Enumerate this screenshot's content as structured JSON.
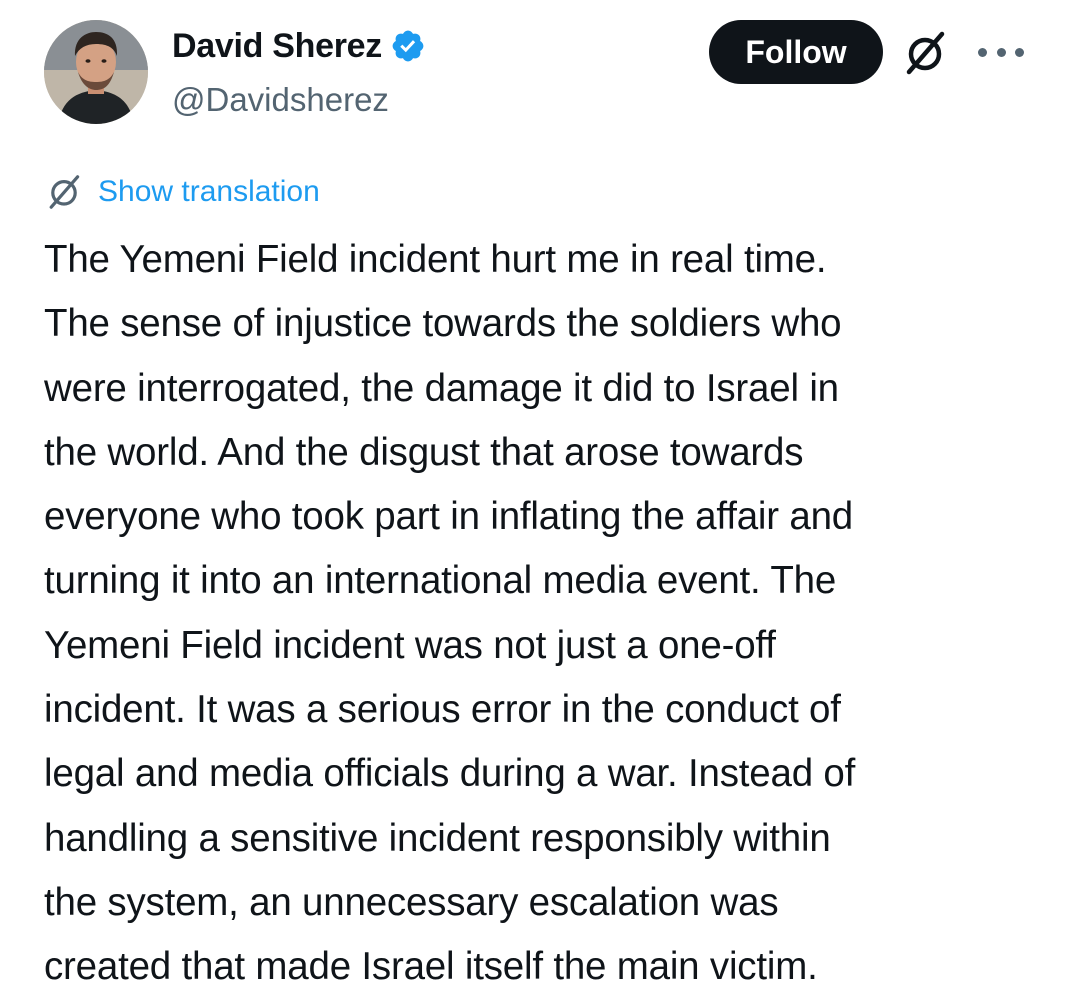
{
  "author": {
    "display_name": "David Sherez",
    "handle": "@Davidsherez",
    "verified": true
  },
  "actions": {
    "follow_label": "Follow",
    "grok_icon": "grok-icon",
    "more_icon": "more-icon"
  },
  "translation": {
    "label": "Show translation"
  },
  "tweet": {
    "lines": [
      "The Yemeni Field incident hurt me in real time.",
      "The sense of injustice towards the soldiers who",
      "were interrogated, the damage it did to Israel in",
      "the world. And the disgust that arose towards",
      "everyone who took part in inflating the affair and",
      "turning it into an international media event. The",
      "Yemeni Field incident was not just a one-off",
      "incident. It was a serious error in the conduct of",
      "legal and media officials during a war. Instead of",
      "handling a sensitive incident responsibly within",
      "the system, an unnecessary escalation was",
      "created that made Israel itself the main victim."
    ]
  },
  "colors": {
    "text": "#0f1419",
    "secondary": "#536471",
    "link": "#1d9bf0",
    "follow_bg": "#0f1419",
    "verified": "#1d9bf0"
  }
}
